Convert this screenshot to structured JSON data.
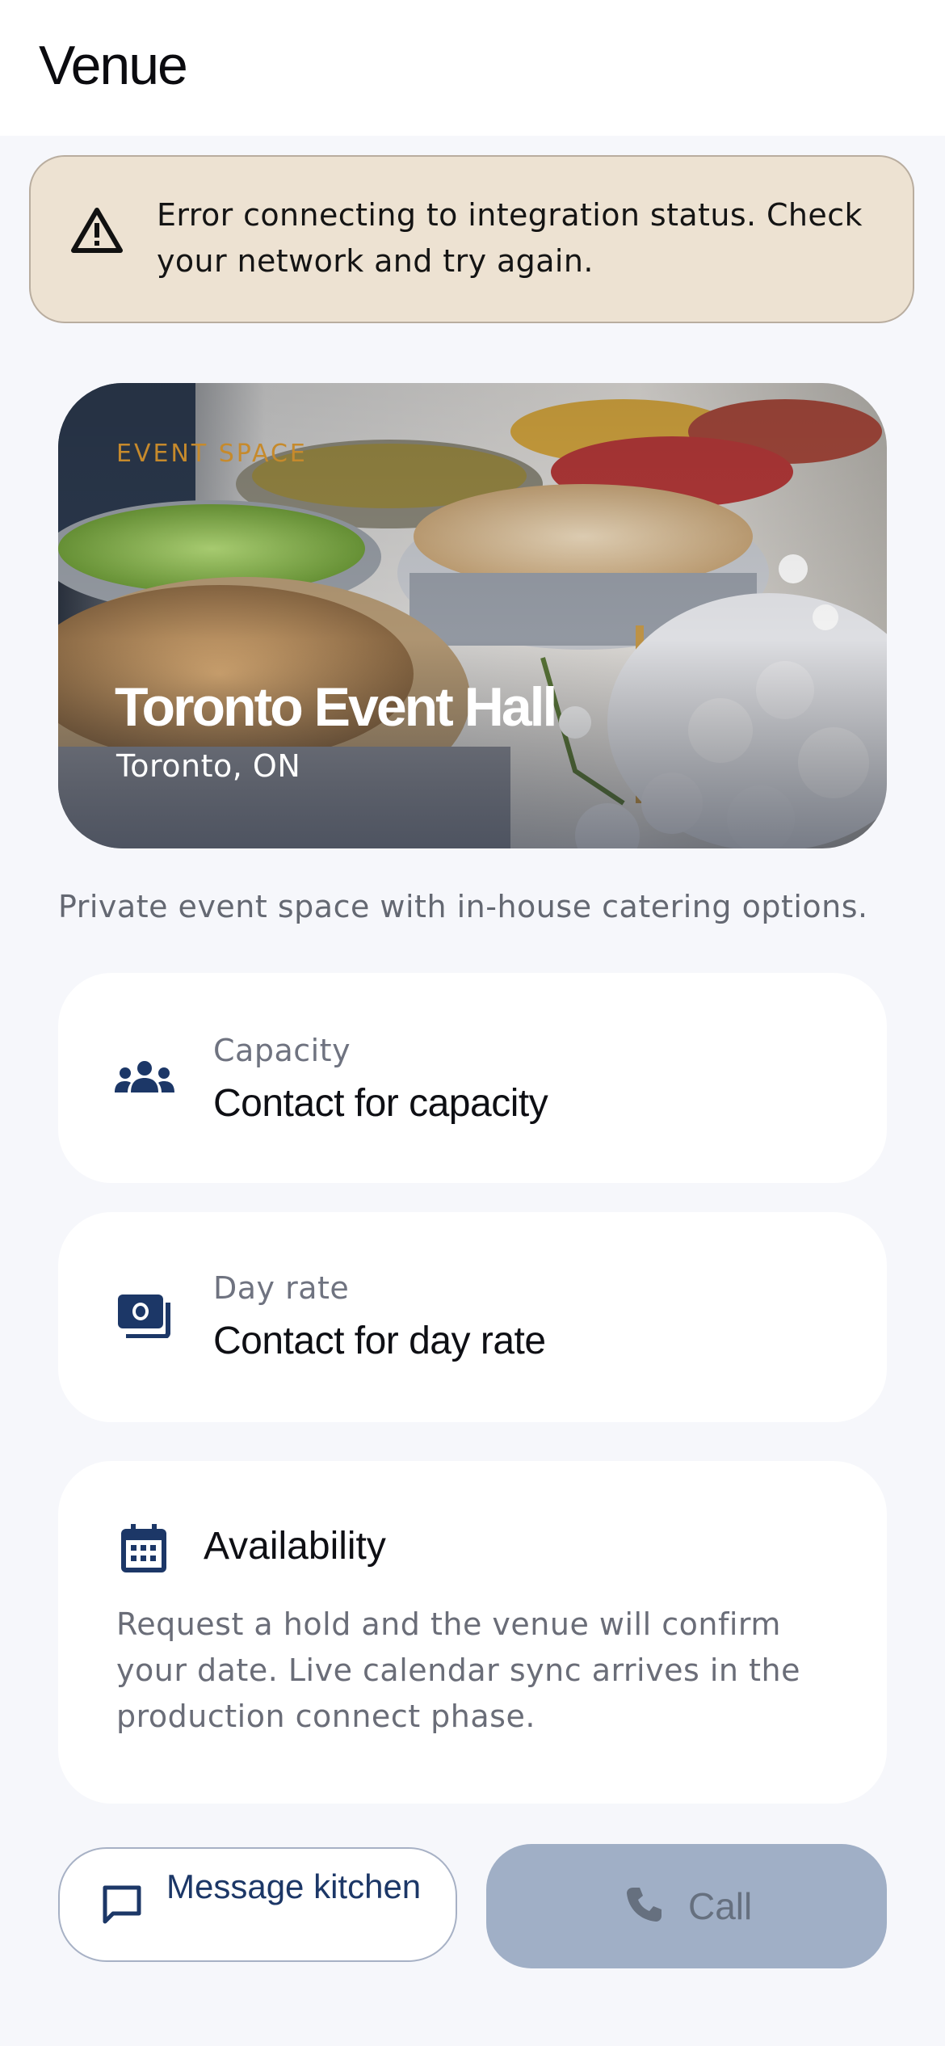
{
  "header": {
    "title": "Venue"
  },
  "error_banner": {
    "icon": "warning-icon",
    "message": "Error connecting to integration status. Check your network and try again."
  },
  "venue": {
    "kicker": "EVENT SPACE",
    "name": "Toronto Event Hall",
    "location": "Toronto, ON",
    "description": "Private event space with in-house catering options."
  },
  "details": [
    {
      "icon": "group-icon",
      "label": "Capacity",
      "value": "Contact for capacity"
    },
    {
      "icon": "money-icon",
      "label": "Day rate",
      "value": "Contact for day rate"
    }
  ],
  "availability": {
    "icon": "calendar-icon",
    "title": "Availability",
    "body": "Request a hold and the venue will confirm your date. Live calendar sync arrives in the production connect phase."
  },
  "actions": {
    "message_label": "Message kitchen",
    "message_icon": "chat-icon",
    "call_label": "Call",
    "call_icon": "phone-icon"
  },
  "colors": {
    "accent": "#1c3767",
    "kicker": "#c68a2c",
    "banner_bg": "#ede2d2",
    "call_disabled": "#a0afc6"
  }
}
